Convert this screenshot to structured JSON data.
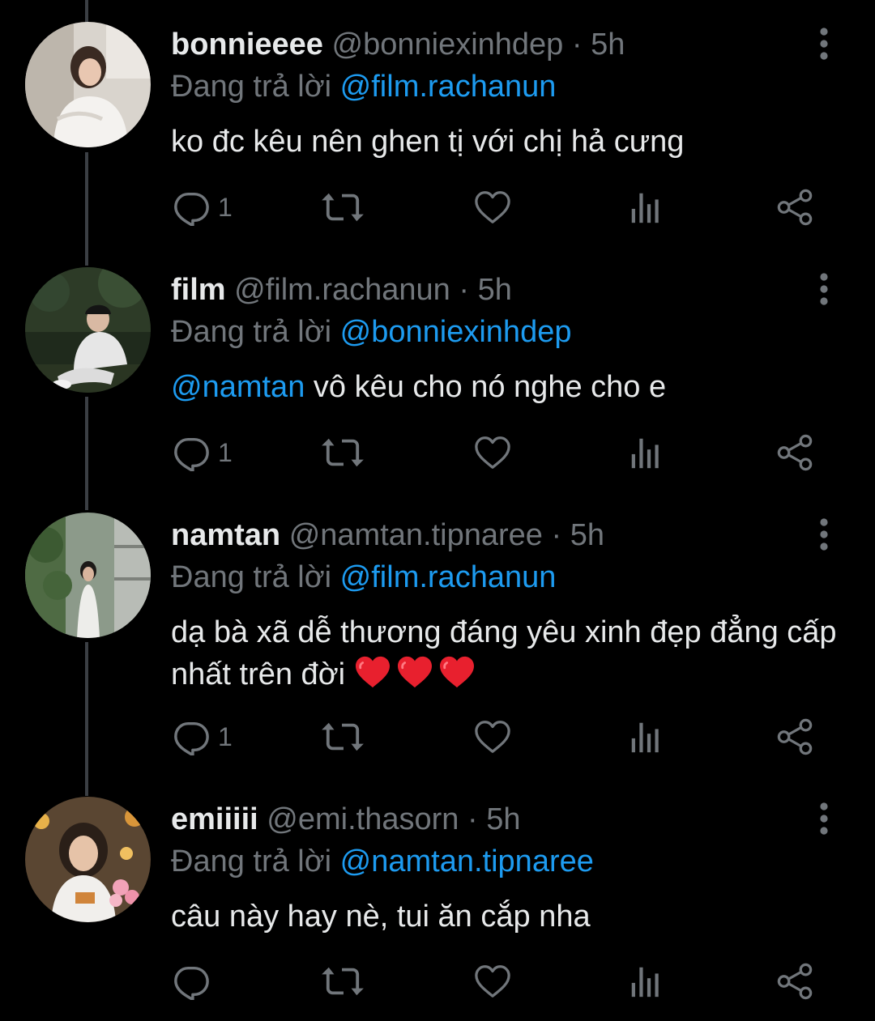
{
  "tweets": [
    {
      "display_name": "bonnieeee",
      "handle": "@bonniexinhdep",
      "separator": "·",
      "time": "5h",
      "reply_prefix": "Đang trả lời",
      "reply_to": "@film.rachanun",
      "text": "ko đc kêu nên ghen tị với chị hả cưng",
      "reply_count": "1"
    },
    {
      "display_name": "film",
      "handle": "@film.rachanun",
      "separator": "·",
      "time": "5h",
      "reply_prefix": "Đang trả lời",
      "reply_to": "@bonniexinhdep",
      "text_mention": "@namtan",
      "text": " vô kêu cho nó nghe cho e",
      "reply_count": "1"
    },
    {
      "display_name": "namtan",
      "handle": "@namtan.tipnaree",
      "separator": "·",
      "time": "5h",
      "reply_prefix": "Đang trả lời",
      "reply_to": "@film.rachanun",
      "text": "dạ bà xã dễ thương đáng yêu xinh đẹp đẳng cấp nhất trên đời ",
      "emoji": [
        "red-heart",
        "red-heart",
        "red-heart"
      ],
      "reply_count": "1"
    },
    {
      "display_name": "emiiiii",
      "handle": "@emi.thasorn",
      "separator": "·",
      "time": "5h",
      "reply_prefix": "Đang trả lời",
      "reply_to": "@namtan.tipnaree",
      "text": "câu này hay nè, tui ăn cắp nha",
      "reply_count": ""
    }
  ],
  "icons": {
    "reply": "reply-icon",
    "retweet": "retweet-icon",
    "like": "heart-icon",
    "views": "analytics-icon",
    "share": "share-icon",
    "more": "more-vertical-icon"
  },
  "colors": {
    "background": "#000000",
    "text": "#e7e9ea",
    "muted": "#71767b",
    "link": "#1d9bf0",
    "thread_line": "#3b3f44",
    "emoji_heart": "#e8202e"
  }
}
